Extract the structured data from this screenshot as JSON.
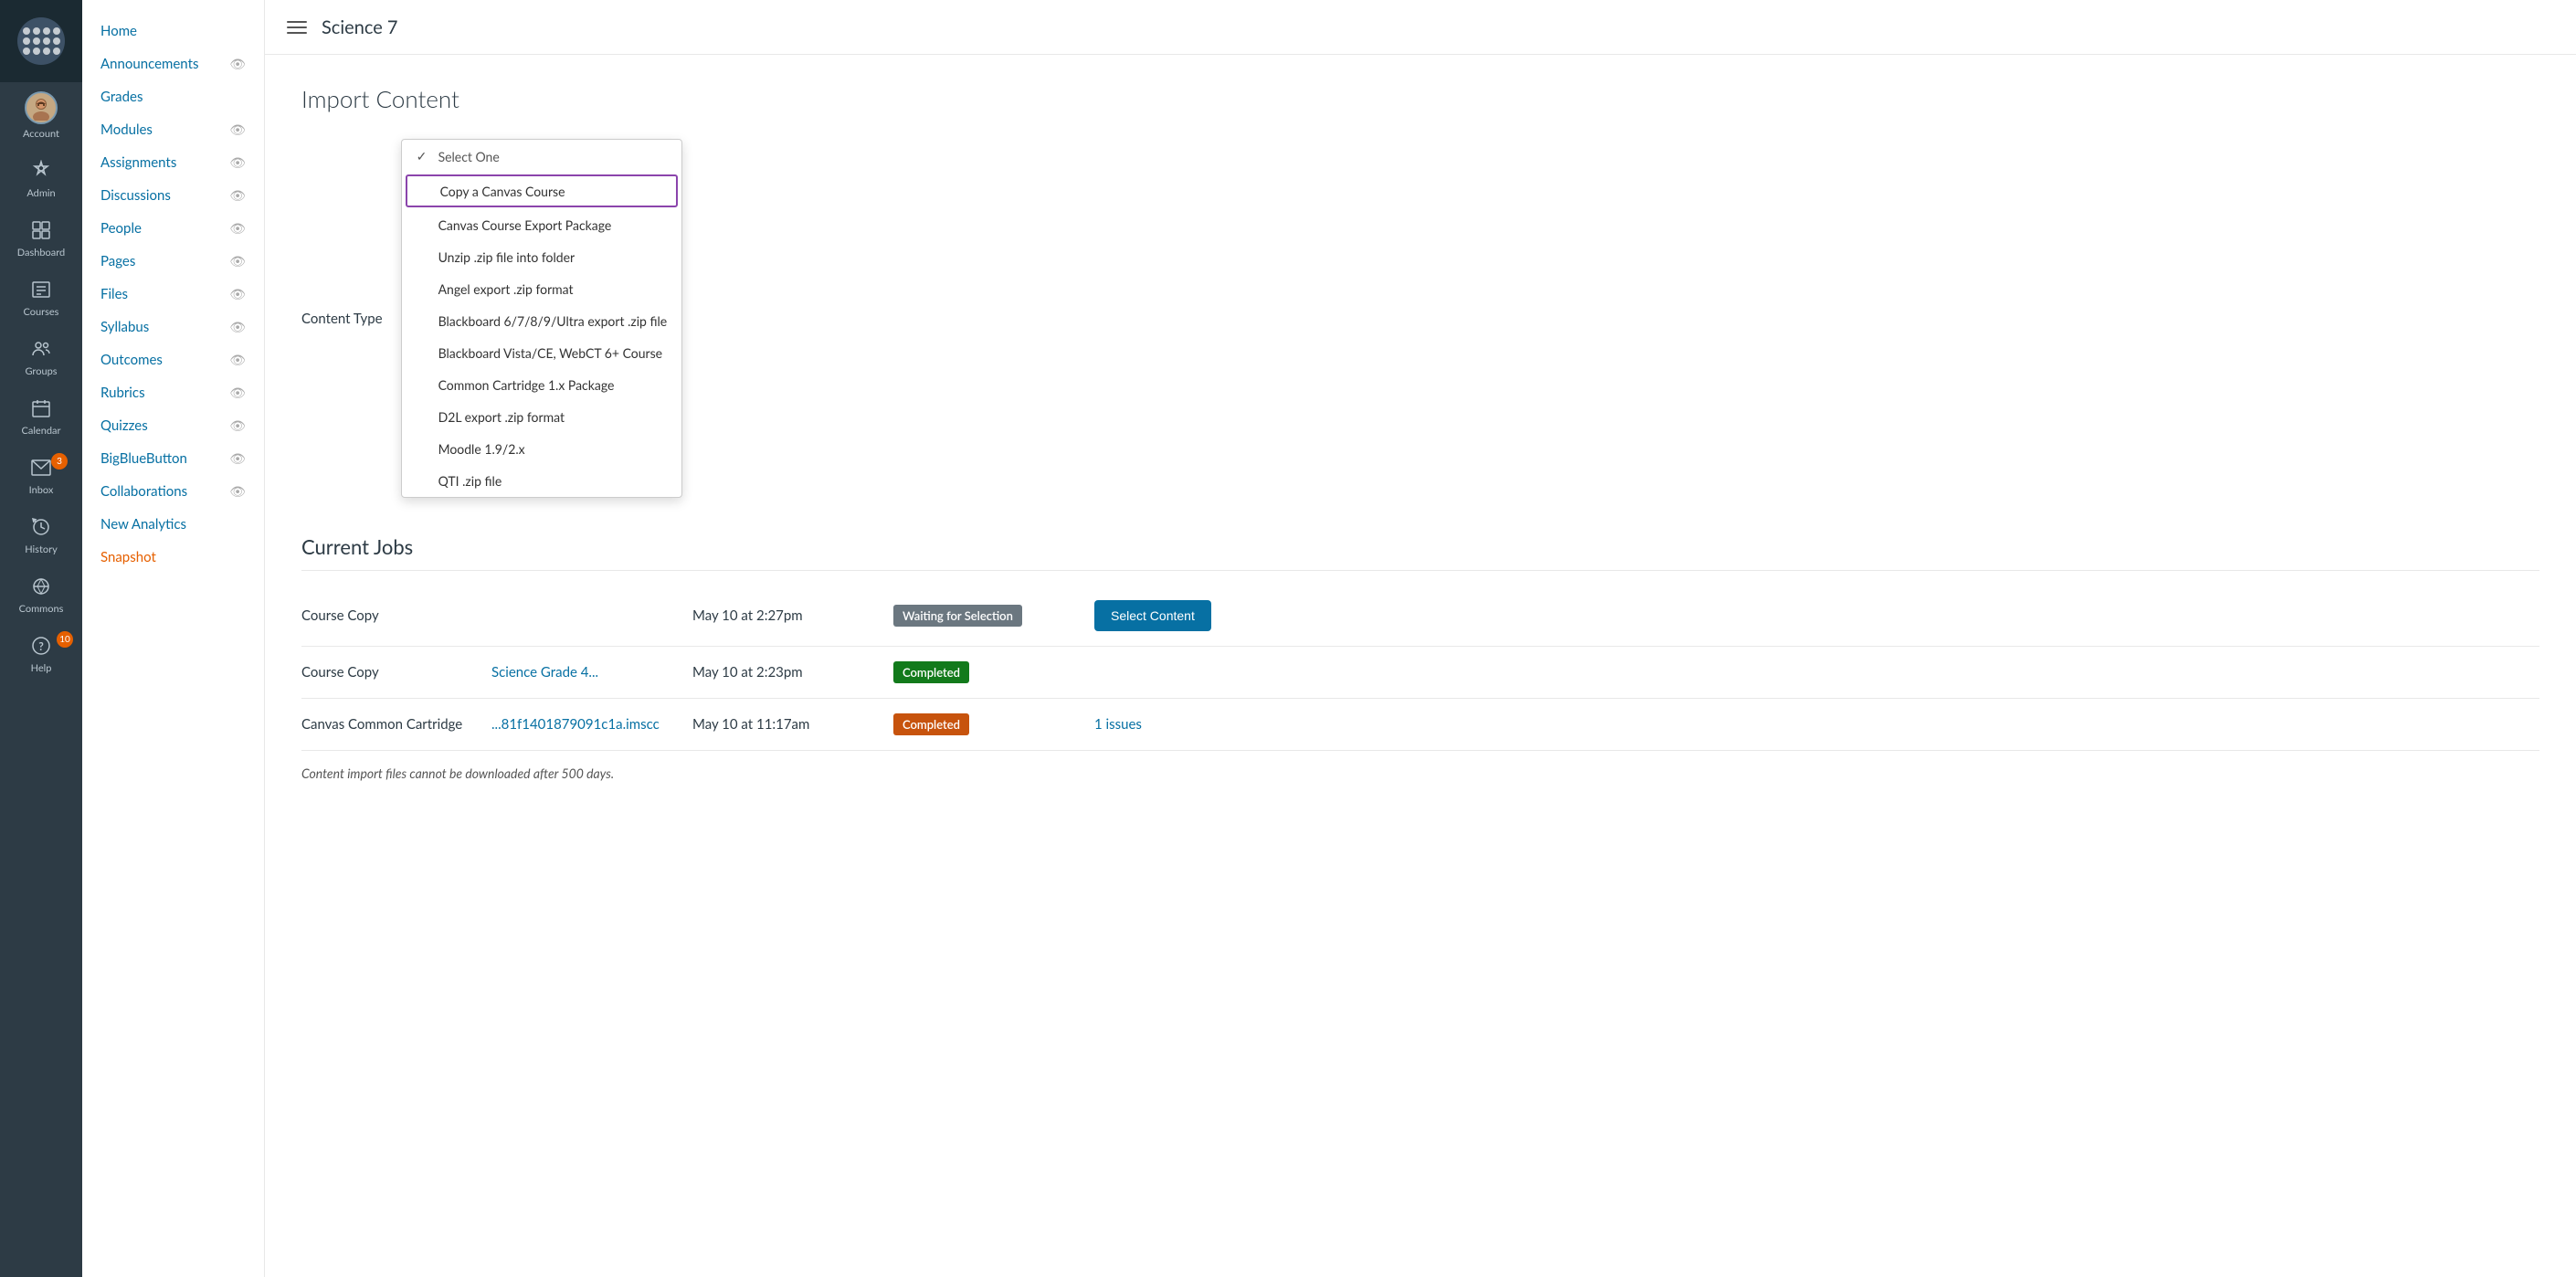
{
  "globalNav": {
    "items": [
      {
        "id": "account",
        "label": "Account",
        "icon": "👤",
        "type": "avatar"
      },
      {
        "id": "admin",
        "label": "Admin",
        "icon": "🛡"
      },
      {
        "id": "dashboard",
        "label": "Dashboard",
        "icon": "⊞"
      },
      {
        "id": "courses",
        "label": "Courses",
        "icon": "📋"
      },
      {
        "id": "groups",
        "label": "Groups",
        "icon": "👥"
      },
      {
        "id": "calendar",
        "label": "Calendar",
        "icon": "📅"
      },
      {
        "id": "inbox",
        "label": "Inbox",
        "icon": "✉",
        "badge": "3"
      },
      {
        "id": "history",
        "label": "History",
        "icon": "↺"
      },
      {
        "id": "commons",
        "label": "Commons",
        "icon": "↗"
      },
      {
        "id": "help",
        "label": "Help",
        "icon": "?",
        "badge": "10"
      }
    ]
  },
  "courseNav": {
    "items": [
      {
        "label": "Home",
        "hasEye": false
      },
      {
        "label": "Announcements",
        "hasEye": true
      },
      {
        "label": "Grades",
        "hasEye": false
      },
      {
        "label": "Modules",
        "hasEye": true
      },
      {
        "label": "Assignments",
        "hasEye": true
      },
      {
        "label": "Discussions",
        "hasEye": true
      },
      {
        "label": "People",
        "hasEye": true
      },
      {
        "label": "Pages",
        "hasEye": true
      },
      {
        "label": "Files",
        "hasEye": true
      },
      {
        "label": "Syllabus",
        "hasEye": true
      },
      {
        "label": "Outcomes",
        "hasEye": true
      },
      {
        "label": "Rubrics",
        "hasEye": true
      },
      {
        "label": "Quizzes",
        "hasEye": true
      },
      {
        "label": "BigBlueButton",
        "hasEye": true
      },
      {
        "label": "Collaborations",
        "hasEye": true
      },
      {
        "label": "New Analytics",
        "hasEye": false
      },
      {
        "label": "Snapshot",
        "hasEye": false
      }
    ]
  },
  "topBar": {
    "courseTitle": "Science 7"
  },
  "page": {
    "title": "Import Content",
    "formLabel": "Content Type",
    "dropdownPlaceholder": "Select One"
  },
  "dropdown": {
    "items": [
      {
        "id": "select-one",
        "label": "Select One",
        "checked": true
      },
      {
        "id": "copy-canvas",
        "label": "Copy a Canvas Course",
        "selected": true
      },
      {
        "id": "canvas-export",
        "label": "Canvas Course Export Package"
      },
      {
        "id": "unzip",
        "label": "Unzip .zip file into folder"
      },
      {
        "id": "angel",
        "label": "Angel export .zip format"
      },
      {
        "id": "blackboard",
        "label": "Blackboard 6/7/8/9/Ultra export .zip file"
      },
      {
        "id": "blackboard-vista",
        "label": "Blackboard Vista/CE, WebCT 6+ Course"
      },
      {
        "id": "common-cartridge",
        "label": "Common Cartridge 1.x Package"
      },
      {
        "id": "d2l",
        "label": "D2L export .zip format"
      },
      {
        "id": "moodle",
        "label": "Moodle 1.9/2.x"
      },
      {
        "id": "qti",
        "label": "QTI .zip file"
      }
    ]
  },
  "currentJobs": {
    "title": "Current Jobs",
    "rows": [
      {
        "type": "Course Copy",
        "source": "",
        "sourceLink": "",
        "date": "May 10 at 2:27pm",
        "status": "Waiting for Selection",
        "statusClass": "waiting",
        "action": "Select Content",
        "issues": ""
      },
      {
        "type": "Course Copy",
        "source": "Science Grade 4...",
        "sourceLink": true,
        "date": "May 10 at 2:23pm",
        "status": "Completed",
        "statusClass": "completed-green",
        "action": "",
        "issues": ""
      },
      {
        "type": "Canvas Common Cartridge",
        "source": "...81f1401879091c1a.imscc",
        "sourceLink": true,
        "date": "May 10 at 11:17am",
        "status": "Completed",
        "statusClass": "completed-orange",
        "action": "",
        "issues": "1 issues"
      }
    ],
    "footnote": "Content import files cannot be downloaded after 500 days."
  }
}
